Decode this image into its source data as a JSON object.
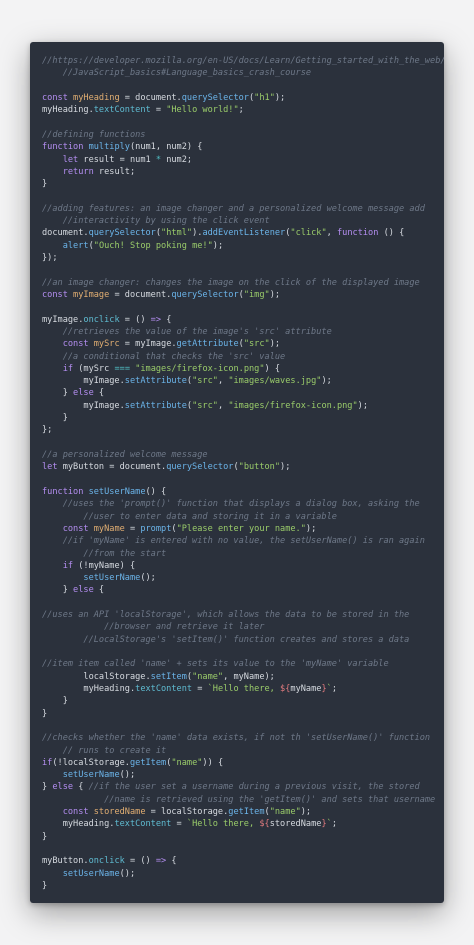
{
  "colors": {
    "page_background": "#f3f3f4",
    "editor_background": "#2b313c",
    "text": "#d6dae0",
    "comment": "#6e7888",
    "keyword": "#b48ef1",
    "name": "#e1ae72",
    "function": "#6bb4e9",
    "string": "#9acc6a",
    "property": "#5fbcd2",
    "operator": "#50bfc4",
    "interpolation": "#e07a7e"
  },
  "code": {
    "language": "javascript",
    "lines": [
      [
        [
          "comment",
          "//https://developer.mozilla.org/en-US/docs/Learn/Getting_started_with_the_web/"
        ]
      ],
      [
        [
          "comment",
          "    //JavaScript_basics#Language_basics_crash_course"
        ]
      ],
      [],
      [
        [
          "keyword",
          "const "
        ],
        [
          "name",
          "myHeading"
        ],
        [
          "text",
          " = document."
        ],
        [
          "fn",
          "querySelector"
        ],
        [
          "text",
          "("
        ],
        [
          "str",
          "\"h1\""
        ],
        [
          "text",
          ");"
        ]
      ],
      [
        [
          "text",
          "myHeading."
        ],
        [
          "prop",
          "textContent"
        ],
        [
          "text",
          " = "
        ],
        [
          "str",
          "\"Hello world!\""
        ],
        [
          "text",
          ";"
        ]
      ],
      [],
      [
        [
          "comment",
          "//defining functions"
        ]
      ],
      [
        [
          "keyword",
          "function "
        ],
        [
          "fn",
          "multiply"
        ],
        [
          "text",
          "(num1, num2) {"
        ]
      ],
      [
        [
          "text",
          "    "
        ],
        [
          "keyword",
          "let"
        ],
        [
          "text",
          " result = num1 "
        ],
        [
          "op",
          "*"
        ],
        [
          "text",
          " num2;"
        ]
      ],
      [
        [
          "text",
          "    "
        ],
        [
          "keyword",
          "return"
        ],
        [
          "text",
          " result;"
        ]
      ],
      [
        [
          "text",
          "}"
        ]
      ],
      [],
      [
        [
          "comment",
          "//adding features: an image changer and a personalized welcome message add"
        ]
      ],
      [
        [
          "comment",
          "    //interactivity by using the click event"
        ]
      ],
      [
        [
          "text",
          "document."
        ],
        [
          "fn",
          "querySelector"
        ],
        [
          "text",
          "("
        ],
        [
          "str",
          "\"html\""
        ],
        [
          "text",
          ")."
        ],
        [
          "fn",
          "addEventListener"
        ],
        [
          "text",
          "("
        ],
        [
          "str",
          "\"click\""
        ],
        [
          "text",
          ", "
        ],
        [
          "keyword",
          "function"
        ],
        [
          "text",
          " () {"
        ]
      ],
      [
        [
          "text",
          "    "
        ],
        [
          "fn",
          "alert"
        ],
        [
          "text",
          "("
        ],
        [
          "str",
          "\"Ouch! Stop poking me!\""
        ],
        [
          "text",
          ");"
        ]
      ],
      [
        [
          "text",
          "});"
        ]
      ],
      [],
      [
        [
          "comment",
          "//an image changer: changes the image on the click of the displayed image"
        ]
      ],
      [
        [
          "keyword",
          "const "
        ],
        [
          "name",
          "myImage"
        ],
        [
          "text",
          " = document."
        ],
        [
          "fn",
          "querySelector"
        ],
        [
          "text",
          "("
        ],
        [
          "str",
          "\"img\""
        ],
        [
          "text",
          ");"
        ]
      ],
      [],
      [
        [
          "text",
          "myImage."
        ],
        [
          "prop",
          "onclick"
        ],
        [
          "text",
          " = () "
        ],
        [
          "keyword",
          "=>"
        ],
        [
          "text",
          " {"
        ]
      ],
      [
        [
          "comment",
          "    //retrieves the value of the image's 'src' attribute"
        ]
      ],
      [
        [
          "text",
          "    "
        ],
        [
          "keyword",
          "const "
        ],
        [
          "name",
          "mySrc"
        ],
        [
          "text",
          " = myImage."
        ],
        [
          "fn",
          "getAttribute"
        ],
        [
          "text",
          "("
        ],
        [
          "str",
          "\"src\""
        ],
        [
          "text",
          ");"
        ]
      ],
      [
        [
          "comment",
          "    //a conditional that checks the 'src' value"
        ]
      ],
      [
        [
          "text",
          "    "
        ],
        [
          "keyword",
          "if"
        ],
        [
          "text",
          " (mySrc "
        ],
        [
          "op",
          "==="
        ],
        [
          "text",
          " "
        ],
        [
          "str",
          "\"images/firefox-icon.png\""
        ],
        [
          "text",
          ") {"
        ]
      ],
      [
        [
          "text",
          "        myImage."
        ],
        [
          "fn",
          "setAttribute"
        ],
        [
          "text",
          "("
        ],
        [
          "str",
          "\"src\""
        ],
        [
          "text",
          ", "
        ],
        [
          "str",
          "\"images/waves.jpg\""
        ],
        [
          "text",
          ");"
        ]
      ],
      [
        [
          "text",
          "    } "
        ],
        [
          "keyword",
          "else"
        ],
        [
          "text",
          " {"
        ]
      ],
      [
        [
          "text",
          "        myImage."
        ],
        [
          "fn",
          "setAttribute"
        ],
        [
          "text",
          "("
        ],
        [
          "str",
          "\"src\""
        ],
        [
          "text",
          ", "
        ],
        [
          "str",
          "\"images/firefox-icon.png\""
        ],
        [
          "text",
          ");"
        ]
      ],
      [
        [
          "text",
          "    }"
        ]
      ],
      [
        [
          "text",
          "};"
        ]
      ],
      [],
      [
        [
          "comment",
          "//a personalized welcome message"
        ]
      ],
      [
        [
          "keyword",
          "let"
        ],
        [
          "text",
          " myButton = document."
        ],
        [
          "fn",
          "querySelector"
        ],
        [
          "text",
          "("
        ],
        [
          "str",
          "\"button\""
        ],
        [
          "text",
          ");"
        ]
      ],
      [],
      [
        [
          "keyword",
          "function "
        ],
        [
          "fn",
          "setUserName"
        ],
        [
          "text",
          "() {"
        ]
      ],
      [
        [
          "comment",
          "    //uses the 'prompt()' function that displays a dialog box, asking the"
        ]
      ],
      [
        [
          "comment",
          "        //user to enter data and storing it in a variable"
        ]
      ],
      [
        [
          "text",
          "    "
        ],
        [
          "keyword",
          "const "
        ],
        [
          "name",
          "myName"
        ],
        [
          "text",
          " = "
        ],
        [
          "fn",
          "prompt"
        ],
        [
          "text",
          "("
        ],
        [
          "str",
          "\"Please enter your name.\""
        ],
        [
          "text",
          ");"
        ]
      ],
      [
        [
          "comment",
          "    //if 'myName' is entered with no value, the setUserName() is ran again"
        ]
      ],
      [
        [
          "comment",
          "        //from the start"
        ]
      ],
      [
        [
          "text",
          "    "
        ],
        [
          "keyword",
          "if"
        ],
        [
          "text",
          " (!myName) {"
        ]
      ],
      [
        [
          "text",
          "        "
        ],
        [
          "fn",
          "setUserName"
        ],
        [
          "text",
          "();"
        ]
      ],
      [
        [
          "text",
          "    } "
        ],
        [
          "keyword",
          "else"
        ],
        [
          "text",
          " {"
        ]
      ],
      [],
      [
        [
          "comment",
          "//uses an API 'localStorage', which allows the data to be stored in the"
        ]
      ],
      [
        [
          "comment",
          "            //browser and retrieve it later"
        ]
      ],
      [
        [
          "comment",
          "        //LocalStorage's 'setItem()' function creates and stores a data"
        ]
      ],
      [],
      [
        [
          "comment",
          "//item item called 'name' + sets its value to the 'myName' variable"
        ]
      ],
      [
        [
          "text",
          "        localStorage."
        ],
        [
          "fn",
          "setItem"
        ],
        [
          "text",
          "("
        ],
        [
          "str",
          "\"name\""
        ],
        [
          "text",
          ", myName);"
        ]
      ],
      [
        [
          "text",
          "        myHeading."
        ],
        [
          "prop",
          "textContent"
        ],
        [
          "text",
          " = "
        ],
        [
          "str",
          "`Hello there, "
        ],
        [
          "interp",
          "${"
        ],
        [
          "text",
          "myName"
        ],
        [
          "interp",
          "}"
        ],
        [
          "str",
          "`"
        ],
        [
          "text",
          ";"
        ]
      ],
      [
        [
          "text",
          "    }"
        ]
      ],
      [
        [
          "text",
          "}"
        ]
      ],
      [],
      [
        [
          "comment",
          "//checks whether the 'name' data exists, if not th 'setUserName()' function"
        ]
      ],
      [
        [
          "comment",
          "    // runs to create it"
        ]
      ],
      [
        [
          "keyword",
          "if"
        ],
        [
          "text",
          "(!localStorage."
        ],
        [
          "fn",
          "getItem"
        ],
        [
          "text",
          "("
        ],
        [
          "str",
          "\"name\""
        ],
        [
          "text",
          ")) {"
        ]
      ],
      [
        [
          "text",
          "    "
        ],
        [
          "fn",
          "setUserName"
        ],
        [
          "text",
          "();"
        ]
      ],
      [
        [
          "text",
          "} "
        ],
        [
          "keyword",
          "else"
        ],
        [
          "text",
          " { "
        ],
        [
          "comment",
          "//if the user set a username during a previous visit, the stored"
        ]
      ],
      [
        [
          "comment",
          "            //name is retrieved using the 'getItem()' and sets that username"
        ]
      ],
      [
        [
          "text",
          "    "
        ],
        [
          "keyword",
          "const "
        ],
        [
          "name",
          "storedName"
        ],
        [
          "text",
          " = localStorage."
        ],
        [
          "fn",
          "getItem"
        ],
        [
          "text",
          "("
        ],
        [
          "str",
          "\"name\""
        ],
        [
          "text",
          ");"
        ]
      ],
      [
        [
          "text",
          "    myHeading."
        ],
        [
          "prop",
          "textContent"
        ],
        [
          "text",
          " = "
        ],
        [
          "str",
          "`Hello there, "
        ],
        [
          "interp",
          "${"
        ],
        [
          "text",
          "storedName"
        ],
        [
          "interp",
          "}"
        ],
        [
          "str",
          "`"
        ],
        [
          "text",
          ";"
        ]
      ],
      [
        [
          "text",
          "}"
        ]
      ],
      [],
      [
        [
          "text",
          "myButton."
        ],
        [
          "prop",
          "onclick"
        ],
        [
          "text",
          " = () "
        ],
        [
          "keyword",
          "=>"
        ],
        [
          "text",
          " {"
        ]
      ],
      [
        [
          "text",
          "    "
        ],
        [
          "fn",
          "setUserName"
        ],
        [
          "text",
          "();"
        ]
      ],
      [
        [
          "text",
          "}"
        ]
      ]
    ]
  }
}
